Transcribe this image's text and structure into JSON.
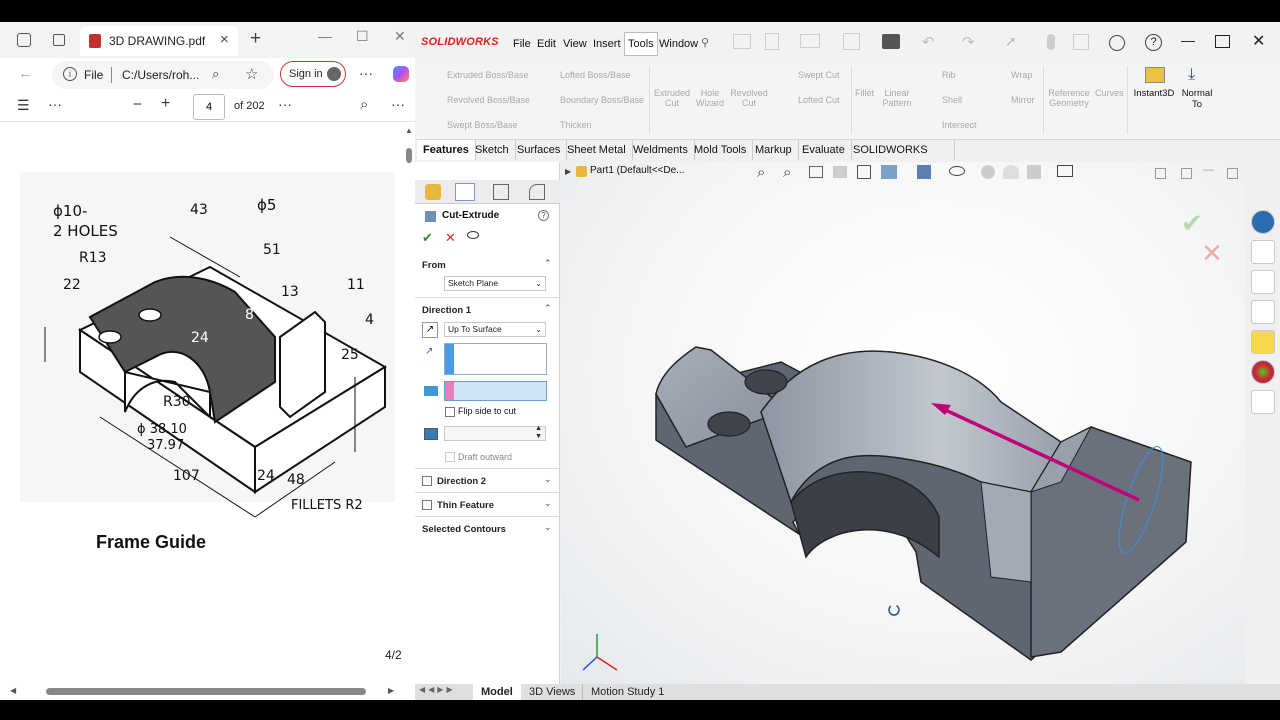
{
  "pdf": {
    "tab_title": "3D DRAWING.pdf",
    "address_prefix": "File",
    "address": "C:/Users/roh...",
    "sign_in": "Sign in",
    "page_current": "4",
    "page_total": "of 202",
    "page_footer": "4/2",
    "drawing": {
      "hole_note_1": "ϕ10-",
      "hole_note_2": "2 HOLES",
      "dim_43": "43",
      "dim_phi5": "ϕ5",
      "dim_r13": "R13",
      "dim_22": "22",
      "dim_51": "51",
      "dim_11": "11",
      "dim_13": "13",
      "dim_24a": "24",
      "dim_8": "8",
      "dim_4": "4",
      "dim_25": "25",
      "dim_r30": "R30",
      "dim_phi38": "ϕ 38.10",
      "dim_3797": "37.97",
      "dim_107": "107",
      "dim_24b": "24",
      "dim_48": "48",
      "fillets": "FILLETS R2",
      "caption": "Frame Guide"
    }
  },
  "sw": {
    "logo": "SOLIDWORKS",
    "menu": [
      "File",
      "Edit",
      "View",
      "Insert",
      "Tools",
      "Window"
    ],
    "commands": {
      "extruded_boss": "Extruded Boss/Base",
      "revolved_boss": "Revolved Boss/Base",
      "swept_boss": "Swept Boss/Base",
      "lofted_boss": "Lofted Boss/Base",
      "boundary_boss": "Boundary Boss/Base",
      "thicken": "Thicken",
      "extruded_cut": "Extruded Cut",
      "hole_wizard": "Hole Wizard",
      "revolved_cut": "Revolved Cut",
      "swept_cut": "Swept Cut",
      "lofted_cut": "Lofted Cut",
      "fillet": "Fillet",
      "linear_pattern": "Linear Pattern",
      "rib": "Rib",
      "shell": "Shell",
      "intersect": "Intersect",
      "wrap": "Wrap",
      "mirror": "Mirror",
      "reference_geometry": "Reference Geometry",
      "curves": "Curves",
      "instant3d": "Instant3D",
      "normal_to": "Normal To"
    },
    "tabs": [
      "Features",
      "Sketch",
      "Surfaces",
      "Sheet Metal",
      "Weldments",
      "Mold Tools",
      "Markup",
      "Evaluate",
      "SOLIDWORKS CAM"
    ],
    "tree_root": "Part1  (Default<<De...",
    "pm": {
      "title": "Cut-Extrude",
      "from_label": "From",
      "from_value": "Sketch Plane",
      "dir1_label": "Direction 1",
      "dir1_value": "Up To Surface",
      "flip": "Flip side to cut",
      "draft": "Draft outward",
      "dir2": "Direction 2",
      "thin": "Thin Feature",
      "contours": "Selected Contours"
    },
    "bottom_tabs": [
      "Model",
      "3D Views",
      "Motion Study 1"
    ],
    "colors": {
      "accent": "#c0007a",
      "brand": "#d22222"
    }
  }
}
